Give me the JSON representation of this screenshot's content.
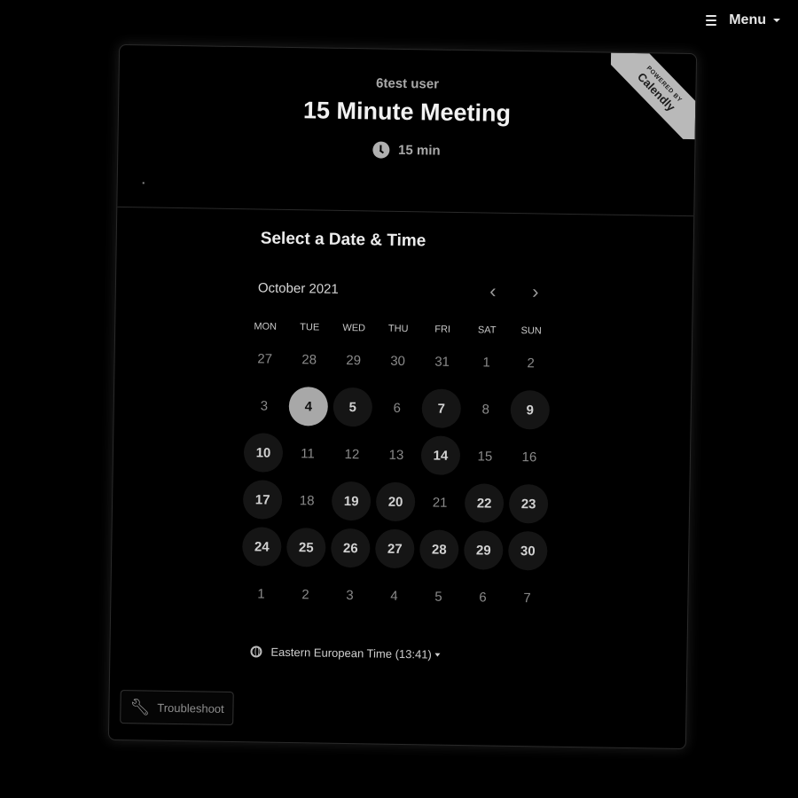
{
  "menu": {
    "label": "Menu"
  },
  "ribbon": {
    "top": "POWERED BY",
    "brand": "Calendly"
  },
  "event": {
    "host": "6test user",
    "title": "15 Minute Meeting",
    "duration": "15 min"
  },
  "scheduler": {
    "heading": "Select a Date & Time",
    "month": "October 2021",
    "weekdays": [
      "MON",
      "TUE",
      "WED",
      "THU",
      "FRI",
      "SAT",
      "SUN"
    ],
    "weeks": [
      [
        {
          "d": "27",
          "s": "muted"
        },
        {
          "d": "28",
          "s": "muted"
        },
        {
          "d": "29",
          "s": "muted"
        },
        {
          "d": "30",
          "s": "muted"
        },
        {
          "d": "31",
          "s": "muted"
        },
        {
          "d": "1",
          "s": "muted"
        },
        {
          "d": "2",
          "s": "muted"
        }
      ],
      [
        {
          "d": "3",
          "s": "muted"
        },
        {
          "d": "4",
          "s": "selected"
        },
        {
          "d": "5",
          "s": "avail"
        },
        {
          "d": "6",
          "s": "muted"
        },
        {
          "d": "7",
          "s": "avail"
        },
        {
          "d": "8",
          "s": "muted"
        },
        {
          "d": "9",
          "s": "avail"
        }
      ],
      [
        {
          "d": "10",
          "s": "avail"
        },
        {
          "d": "11",
          "s": "muted"
        },
        {
          "d": "12",
          "s": "muted"
        },
        {
          "d": "13",
          "s": "muted"
        },
        {
          "d": "14",
          "s": "avail"
        },
        {
          "d": "15",
          "s": "muted"
        },
        {
          "d": "16",
          "s": "muted"
        }
      ],
      [
        {
          "d": "17",
          "s": "avail"
        },
        {
          "d": "18",
          "s": "muted"
        },
        {
          "d": "19",
          "s": "avail"
        },
        {
          "d": "20",
          "s": "avail"
        },
        {
          "d": "21",
          "s": "muted"
        },
        {
          "d": "22",
          "s": "avail"
        },
        {
          "d": "23",
          "s": "avail"
        }
      ],
      [
        {
          "d": "24",
          "s": "avail"
        },
        {
          "d": "25",
          "s": "avail"
        },
        {
          "d": "26",
          "s": "avail"
        },
        {
          "d": "27",
          "s": "avail"
        },
        {
          "d": "28",
          "s": "avail"
        },
        {
          "d": "29",
          "s": "avail"
        },
        {
          "d": "30",
          "s": "avail"
        }
      ],
      [
        {
          "d": "1",
          "s": "muted"
        },
        {
          "d": "2",
          "s": "muted"
        },
        {
          "d": "3",
          "s": "muted"
        },
        {
          "d": "4",
          "s": "muted"
        },
        {
          "d": "5",
          "s": "muted"
        },
        {
          "d": "6",
          "s": "muted"
        },
        {
          "d": "7",
          "s": "muted"
        }
      ]
    ],
    "timezone": "Eastern European Time (13:41)"
  },
  "troubleshoot": {
    "label": "Troubleshoot"
  }
}
